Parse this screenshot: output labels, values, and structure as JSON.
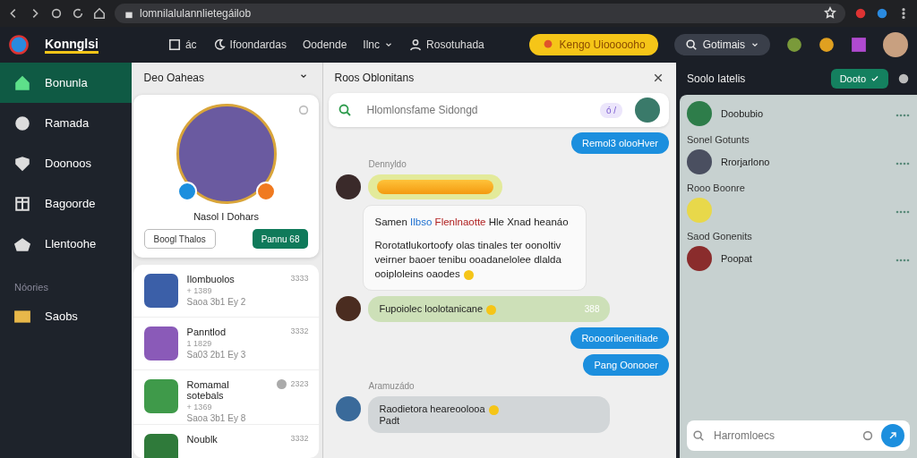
{
  "browser": {
    "url": "lomnilalulannlietegáilob"
  },
  "header": {
    "brand": "Konnglsi",
    "nav": [
      {
        "label": "ác",
        "dropdown": false
      },
      {
        "label": "Ifoondardas",
        "dropdown": false
      },
      {
        "label": "Oodende",
        "dropdown": false
      },
      {
        "label": "Ilnc",
        "dropdown": true
      },
      {
        "label": "Rosotuhada",
        "dropdown": false
      }
    ],
    "promo": "Kengo Uioooooho",
    "search_button": "Gotimais"
  },
  "sidebar": {
    "items": [
      {
        "label": "Bonunla",
        "selected": true
      },
      {
        "label": "Ramada",
        "selected": false
      },
      {
        "label": "Doonoos",
        "selected": false
      },
      {
        "label": "Bagoorde",
        "selected": false
      },
      {
        "label": "Llentoohe",
        "selected": false
      }
    ],
    "section": "Nóories",
    "section_items": [
      {
        "label": "Saobs",
        "selected": false
      }
    ]
  },
  "profile": {
    "title": "Deo Oaheas",
    "name": "Nasol I Dohars",
    "buttons": [
      {
        "label": "Boogl Thalos",
        "kind": "outline"
      },
      {
        "label": "Pannu 68",
        "kind": "primary"
      }
    ]
  },
  "games": [
    {
      "title": "Ilombuolos",
      "count": "+ 1389",
      "meta": "Saoa 3b1 Ey 2",
      "time": "3333",
      "color": "#3b5fa8",
      "badge": false
    },
    {
      "title": "Panntlod",
      "count": "1 1829",
      "meta": "Sa03 2b1 Ey 3",
      "time": "3332",
      "color": "#8a5ab8",
      "badge": false
    },
    {
      "title": "Romamal sotebals",
      "count": "+ 1369",
      "meta": "Saoa 3b1 Ey 8",
      "time": "2323",
      "color": "#3f9a4a",
      "badge": true
    },
    {
      "title": "Noublk",
      "time": "3332",
      "color": "#2f7a3a",
      "badge": false
    }
  ],
  "chat": {
    "title": "Roos Oblonitans",
    "search_placeholder": "Hlomlonsfame Sidongd",
    "search_badge": "ó /",
    "messages": [
      {
        "kind": "out",
        "text": "Remol3 olooHver"
      },
      {
        "kind": "bar",
        "sender": "Dennyldo"
      },
      {
        "kind": "card",
        "parts": [
          {
            "text": "Samen "
          },
          {
            "text": "Ilbso",
            "color": "#1c6fd0"
          },
          {
            "text": " Flenlnaotte",
            "color": "#b02020"
          },
          {
            "text": " Hle Xnad heanáo"
          }
        ],
        "body": "Rorotatlukortoofy olas tinales ter oonoltiv veirner baoer tenibu ooadanelolee dlalda ooiploleins oaodes"
      },
      {
        "kind": "green",
        "text": "Fupoiolec loolotanicane",
        "time": "388"
      },
      {
        "kind": "out",
        "text": "Rooooriloenitiade"
      },
      {
        "kind": "out",
        "text": "Pang Oonooer"
      },
      {
        "kind": "gray",
        "sender": "Aramuzádo",
        "text": "Raodietora heareoolooa",
        "text2": "Padt"
      }
    ]
  },
  "right": {
    "title": "Soolo Iatelis",
    "button": "Dooto",
    "contacts": [
      {
        "name": "Doobubio",
        "color": "#2e7d4a"
      },
      {
        "name": "Rrorjarlono",
        "group": "Sonel Gotunts",
        "color": "#4a4f60"
      },
      {
        "group": "Rooo Boonre",
        "color": "#e8d84a"
      },
      {
        "name": "Poopat",
        "group": "Saod Gonenits",
        "color": "#8a2c2c"
      }
    ],
    "input_placeholder": "Harromloecs"
  }
}
